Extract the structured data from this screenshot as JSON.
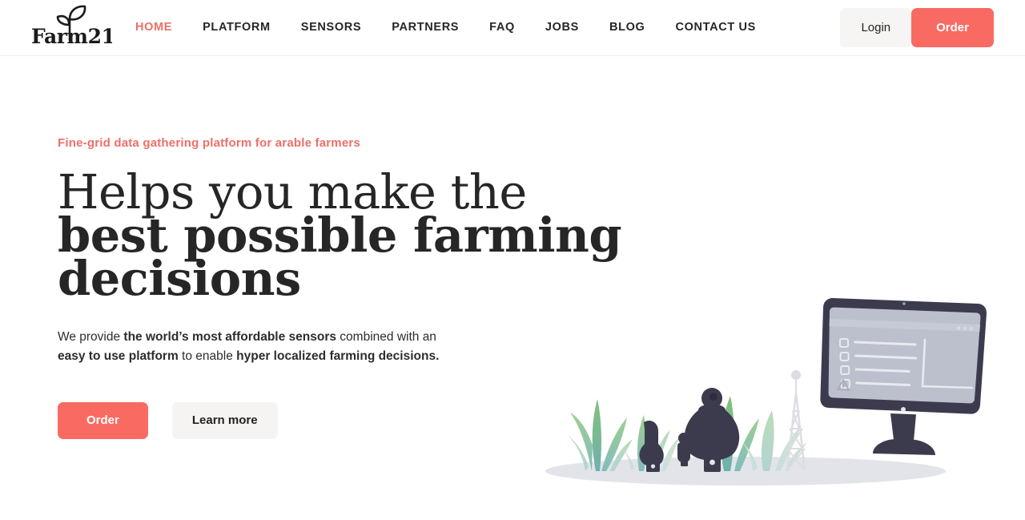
{
  "brand": {
    "name": "Farm21",
    "logo_icon": "sprout-icon",
    "accent_color": "#f96a62",
    "eyebrow_color": "#ee6f68"
  },
  "header": {
    "nav_items": [
      {
        "label": "HOME",
        "active": true
      },
      {
        "label": "PLATFORM",
        "active": false
      },
      {
        "label": "SENSORS",
        "active": false
      },
      {
        "label": "PARTNERS",
        "active": false
      },
      {
        "label": "FAQ",
        "active": false
      },
      {
        "label": "JOBS",
        "active": false
      },
      {
        "label": "BLOG",
        "active": false
      },
      {
        "label": "CONTACT US",
        "active": false
      }
    ],
    "login_label": "Login",
    "order_label": "Order"
  },
  "hero": {
    "eyebrow": "Fine-grid data gathering platform for arable farmers",
    "headline_line1": "Helps you make the",
    "headline_line2": "best possible farming",
    "headline_line3": "decisions",
    "paragraph_part1": "We provide ",
    "paragraph_bold1": "the world’s most affordable sensors",
    "paragraph_part2": " combined with an ",
    "paragraph_bold2": "easy to use platform",
    "paragraph_part3": " to enable ",
    "paragraph_bold3": "hyper localized farming decisions.",
    "primary_cta": "Order",
    "secondary_cta": "Learn more",
    "illustration_name": "farm-sensors-dashboard-illustration"
  }
}
